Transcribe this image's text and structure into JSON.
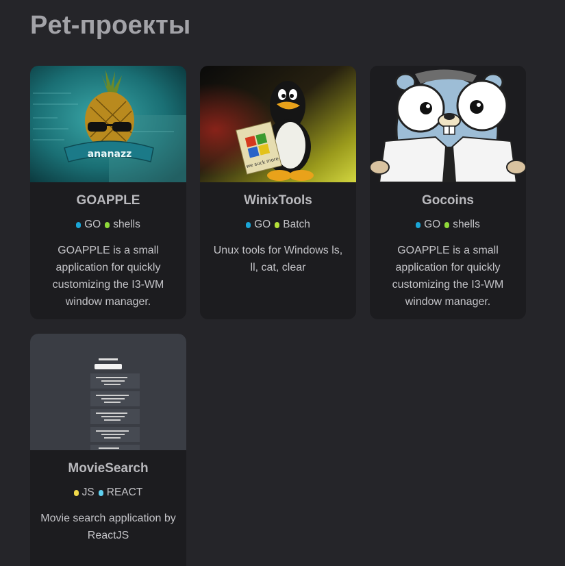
{
  "section": {
    "title": "Pet-проекты"
  },
  "colors": {
    "page_bg": "#252529",
    "card_bg": "#1c1c1f",
    "go": "#1aa5d6",
    "shells": "#8fd83a",
    "batch": "#b5e03a",
    "js": "#f0d84a",
    "react": "#5fd0f0"
  },
  "projects": [
    {
      "title": "GOAPPLE",
      "image": "pineapple-logo-image",
      "tags": [
        {
          "label": "GO",
          "color": "#1aa5d6"
        },
        {
          "label": "shells",
          "color": "#8fd83a"
        }
      ],
      "description": "GOAPPLE is a small application for quickly customizing the I3-WM window manager."
    },
    {
      "title": "WinixTools",
      "image": "tux-penguin-image",
      "tags": [
        {
          "label": "GO",
          "color": "#1aa5d6"
        },
        {
          "label": "Batch",
          "color": "#b5e03a"
        }
      ],
      "description": "Unux tools for Windows ls, ll, cat, clear"
    },
    {
      "title": "Gocoins",
      "image": "gopher-image",
      "tags": [
        {
          "label": "GO",
          "color": "#1aa5d6"
        },
        {
          "label": "shells",
          "color": "#8fd83a"
        }
      ],
      "description": "GOAPPLE is a small application for quickly customizing the I3-WM window manager."
    },
    {
      "title": "MovieSearch",
      "image": "movie-search-screenshot-image",
      "tags": [
        {
          "label": "JS",
          "color": "#f0d84a"
        },
        {
          "label": "REACT",
          "color": "#5fd0f0"
        }
      ],
      "description": "Movie search application by ReactJS"
    }
  ]
}
